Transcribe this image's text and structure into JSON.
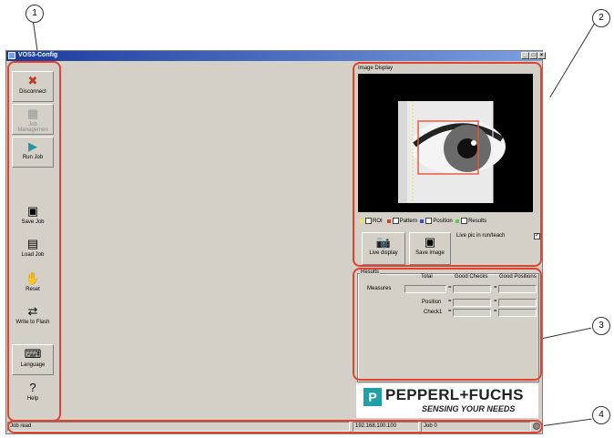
{
  "window": {
    "title": "VOS3-Config"
  },
  "callouts": [
    "1",
    "2",
    "3",
    "4"
  ],
  "toolbar": {
    "buttons": [
      {
        "label": "Disconnect",
        "icon": "disconnect-icon"
      },
      {
        "label": "Job Managemen",
        "icon": "puzzle-icon"
      },
      {
        "label": "Run Job",
        "icon": "play-icon"
      },
      {
        "label": "Save Job",
        "icon": "floppy-icon"
      },
      {
        "label": "Load Job",
        "icon": "folder-icon"
      },
      {
        "label": "Reset",
        "icon": "hand-icon"
      },
      {
        "label": "Write to Flash",
        "icon": "transfer-icon"
      },
      {
        "label": "Language",
        "icon": "language-icon"
      },
      {
        "label": "Help",
        "icon": "help-icon"
      }
    ]
  },
  "image_display": {
    "title": "Image Display",
    "legend": [
      {
        "label": "ROI",
        "color": "#e8e84a"
      },
      {
        "label": "Pattern",
        "color": "#e83a2a"
      },
      {
        "label": "Position",
        "color": "#3a4ad8"
      },
      {
        "label": "Results",
        "color": "#5ac85a"
      }
    ],
    "live_display_label": "Live display",
    "save_image_label": "Save image",
    "live_pic_label": "Live pic in run/teach",
    "live_pic_checked": true
  },
  "results": {
    "title": "Results",
    "headers": [
      "Total",
      "Good Checks",
      "Good Positions"
    ],
    "measures_label": "Measures",
    "position_label": "Position",
    "check1_label": "Check1",
    "eq": "="
  },
  "brand": {
    "name": "PEPPERL+FUCHS",
    "tagline": "SENSING YOUR NEEDS",
    "color": "#1fa0a8"
  },
  "status": {
    "message": "Job read",
    "ip": "192.168.100.100",
    "job": "Job 0"
  }
}
